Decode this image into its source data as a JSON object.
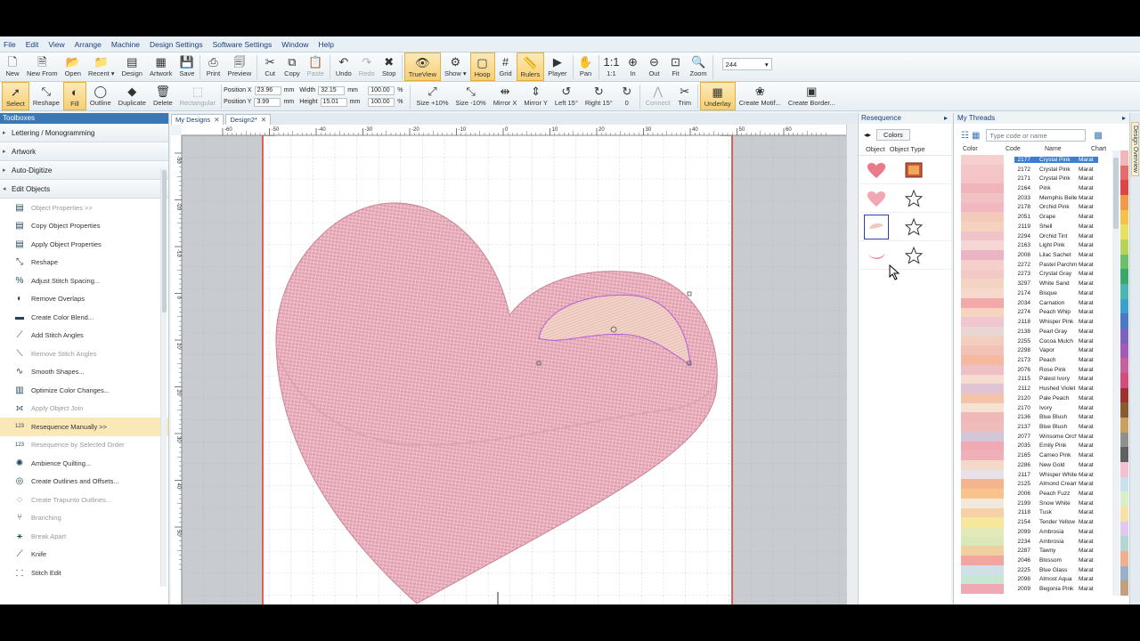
{
  "menu": [
    "File",
    "Edit",
    "View",
    "Arrange",
    "Machine",
    "Design Settings",
    "Software Settings",
    "Window",
    "Help"
  ],
  "toolbar1": [
    {
      "label": "New",
      "icon": "new-file-icon",
      "glyph": "🗋"
    },
    {
      "label": "New From",
      "icon": "new-from-icon",
      "glyph": "🗎"
    },
    {
      "label": "Open",
      "icon": "open-folder-icon",
      "glyph": "📂"
    },
    {
      "label": "Recent ▾",
      "icon": "recent-icon",
      "glyph": "📁"
    },
    {
      "label": "Design",
      "icon": "design-icon",
      "glyph": "▤"
    },
    {
      "label": "Artwork",
      "icon": "artwork-icon",
      "glyph": "▦"
    },
    {
      "label": "Save",
      "icon": "save-icon",
      "glyph": "💾"
    },
    {
      "label": "Print",
      "icon": "print-icon",
      "glyph": "⎙"
    },
    {
      "label": "Preview",
      "icon": "preview-icon",
      "glyph": "🗐"
    },
    {
      "label": "Cut",
      "icon": "cut-icon",
      "glyph": "✂"
    },
    {
      "label": "Copy",
      "icon": "copy-icon",
      "glyph": "⧉"
    },
    {
      "label": "Paste",
      "icon": "paste-icon",
      "glyph": "📋",
      "disabled": true
    },
    {
      "label": "Undo",
      "icon": "undo-icon",
      "glyph": "↶"
    },
    {
      "label": "Redo",
      "icon": "redo-icon",
      "glyph": "↷",
      "disabled": true
    },
    {
      "label": "Stop",
      "icon": "stop-icon",
      "glyph": "✖"
    },
    {
      "label": "TrueView",
      "icon": "trueview-icon",
      "glyph": "👁",
      "active": true
    },
    {
      "label": "Show ▾",
      "icon": "show-icon",
      "glyph": "⚙"
    },
    {
      "label": "Hoop",
      "icon": "hoop-icon",
      "glyph": "▢",
      "active": true
    },
    {
      "label": "Grid",
      "icon": "grid-icon",
      "glyph": "#"
    },
    {
      "label": "Rulers",
      "icon": "rulers-icon",
      "glyph": "📏",
      "active": true
    },
    {
      "label": "Player",
      "icon": "player-icon",
      "glyph": "▶"
    },
    {
      "label": "Pan",
      "icon": "pan-icon",
      "glyph": "✋"
    },
    {
      "label": "1:1",
      "icon": "actual-size-icon",
      "glyph": "1:1"
    },
    {
      "label": "In",
      "icon": "zoom-in-icon",
      "glyph": "⊕"
    },
    {
      "label": "Out",
      "icon": "zoom-out-icon",
      "glyph": "⊖"
    },
    {
      "label": "Fit",
      "icon": "zoom-fit-icon",
      "glyph": "⊡"
    },
    {
      "label": "Zoom",
      "icon": "zoom-icon",
      "glyph": "🔍"
    }
  ],
  "zoom_value": "244",
  "toolbar2": [
    {
      "label": "Select",
      "icon": "select-arrow-icon",
      "glyph": "➚",
      "active": true
    },
    {
      "label": "Reshape",
      "icon": "reshape-icon",
      "glyph": "⤡"
    },
    {
      "label": "Fill",
      "icon": "fill-icon",
      "glyph": "◐",
      "active": true
    },
    {
      "label": "Outline",
      "icon": "outline-icon",
      "glyph": "◯"
    },
    {
      "label": "Duplicate",
      "icon": "duplicate-icon",
      "glyph": "◆"
    },
    {
      "label": "Delete",
      "icon": "delete-icon",
      "glyph": "🗑"
    },
    {
      "label": "Rectangular",
      "icon": "rectangular-select-icon",
      "glyph": "⬚",
      "disabled": true
    }
  ],
  "position": {
    "x_label": "Position X",
    "x_value": "23.96",
    "y_label": "Position Y",
    "y_value": "3.99",
    "unit": "mm"
  },
  "size": {
    "w_label": "Width",
    "w_value": "32.15",
    "h_label": "Height",
    "h_value": "15.01",
    "unit": "mm",
    "pw": "100.00",
    "ph": "100.00",
    "pct": "%"
  },
  "toolbar2b": [
    {
      "label": "Size +10%",
      "icon": "size-up-icon",
      "glyph": "⤢"
    },
    {
      "label": "Size -10%",
      "icon": "size-down-icon",
      "glyph": "⤡"
    },
    {
      "label": "Mirror X",
      "icon": "mirror-x-icon",
      "glyph": "⇹"
    },
    {
      "label": "Mirror Y",
      "icon": "mirror-y-icon",
      "glyph": "⇕"
    },
    {
      "label": "Left 15°",
      "icon": "rotate-left-icon",
      "glyph": "↺"
    },
    {
      "label": "Right 15°",
      "icon": "rotate-right-icon",
      "glyph": "↻"
    },
    {
      "label": "0",
      "icon": "rotate-angle-icon",
      "glyph": "↻"
    },
    {
      "label": "Connect",
      "icon": "connect-icon",
      "glyph": "⋀",
      "disabled": true
    },
    {
      "label": "Trim",
      "icon": "trim-icon",
      "glyph": "✂"
    },
    {
      "label": "Underlay",
      "icon": "underlay-icon",
      "glyph": "▦",
      "active": true
    },
    {
      "label": "Create Motif...",
      "icon": "motif-icon",
      "glyph": "❀"
    },
    {
      "label": "Create Border...",
      "icon": "border-icon",
      "glyph": "▣"
    }
  ],
  "toolbox": {
    "title": "Toolboxes",
    "categories": [
      {
        "label": "Lettering / Monogramming",
        "arrow": "▸"
      },
      {
        "label": "Artwork",
        "arrow": "▸"
      },
      {
        "label": "Auto-Digitize",
        "arrow": "▸"
      },
      {
        "label": "Edit Objects",
        "arrow": "◂"
      }
    ],
    "tools": [
      {
        "label": "Object Properties >>",
        "icon": "object-properties-icon",
        "glyph": "▤",
        "dim": true
      },
      {
        "label": "Copy Object Properties",
        "icon": "copy-properties-icon",
        "glyph": "▤"
      },
      {
        "label": "Apply Object Properties",
        "icon": "apply-properties-icon",
        "glyph": "▤"
      },
      {
        "label": "Reshape",
        "icon": "reshape-tool-icon",
        "glyph": "⤡"
      },
      {
        "label": "Adjust Stitch Spacing...",
        "icon": "stitch-spacing-icon",
        "glyph": "%"
      },
      {
        "label": "Remove Overlaps",
        "icon": "remove-overlaps-icon",
        "glyph": "◐"
      },
      {
        "label": "Create Color Blend...",
        "icon": "color-blend-icon",
        "glyph": "▬"
      },
      {
        "label": "Add Stitch Angles",
        "icon": "add-angles-icon",
        "glyph": "⟋"
      },
      {
        "label": "Remove Stitch Angles",
        "icon": "remove-angles-icon",
        "glyph": "⟍",
        "dim": true
      },
      {
        "label": "Smooth Shapes...",
        "icon": "smooth-shapes-icon",
        "glyph": "∿"
      },
      {
        "label": "Optimize Color Changes...",
        "icon": "optimize-colors-icon",
        "glyph": "▥"
      },
      {
        "label": "Apply Object Join",
        "icon": "object-join-icon",
        "glyph": "⟗",
        "dim": true
      },
      {
        "label": "Resequence Manually >>",
        "icon": "resequence-manual-icon",
        "glyph": "123",
        "sel": true
      },
      {
        "label": "Resequence by Selected Order",
        "icon": "resequence-order-icon",
        "glyph": "123",
        "dim": true
      },
      {
        "label": "Ambience Quilting...",
        "icon": "ambience-quilting-icon",
        "glyph": "✺"
      },
      {
        "label": "Create Outlines and Offsets...",
        "icon": "outlines-offsets-icon",
        "glyph": "◎"
      },
      {
        "label": "Create Trapunto Outlines...",
        "icon": "trapunto-icon",
        "glyph": "◌",
        "dim": true
      },
      {
        "label": "Branching",
        "icon": "branching-icon",
        "glyph": "⑂",
        "dim": true
      },
      {
        "label": "Break Apart",
        "icon": "break-apart-icon",
        "glyph": "⚹",
        "dim": true
      },
      {
        "label": "Knife",
        "icon": "knife-icon",
        "glyph": "⟋"
      },
      {
        "label": "Stitch Edit",
        "icon": "stitch-edit-icon",
        "glyph": "⸬"
      }
    ]
  },
  "tabs": [
    {
      "label": "My Designs"
    },
    {
      "label": "Design2*"
    }
  ],
  "ruler": {
    "h": [
      "-60",
      "-50",
      "-40",
      "-30",
      "-20",
      "-10",
      "0",
      "10",
      "20",
      "30",
      "40",
      "50",
      "60"
    ],
    "v": [
      "-30",
      "-20",
      "-10",
      "0",
      "10",
      "20",
      "30",
      "40",
      "50"
    ]
  },
  "resequence": {
    "title": "Resequence",
    "colors_label": "Colors",
    "col_object": "Object",
    "col_type": "Object Type"
  },
  "threads": {
    "title": "My Threads",
    "placeholder": "Type code or name",
    "headers": [
      "Color",
      "Code",
      "Name",
      "Chart"
    ],
    "rows": [
      {
        "c": "#f6cfcf",
        "code": "2177",
        "name": "Crystal Pink",
        "chart": "Marat",
        "sel": true
      },
      {
        "c": "#f4c6c8",
        "code": "2172",
        "name": "Crystal Pink",
        "chart": "Marat"
      },
      {
        "c": "#f3c3c6",
        "code": "2171",
        "name": "Crystal Pink",
        "chart": "Marat"
      },
      {
        "c": "#f2b4bb",
        "code": "2164",
        "name": "Pink",
        "chart": "Marat"
      },
      {
        "c": "#f0c2c4",
        "code": "2033",
        "name": "Memphis Belle",
        "chart": "Marat"
      },
      {
        "c": "#f2b8c2",
        "code": "2178",
        "name": "Orchid Pink",
        "chart": "Marat"
      },
      {
        "c": "#f3c9ba",
        "code": "2051",
        "name": "Grape",
        "chart": "Marat"
      },
      {
        "c": "#f5d2c0",
        "code": "2119",
        "name": "Shell",
        "chart": "Marat"
      },
      {
        "c": "#f0c4c8",
        "code": "2294",
        "name": "Orchid Tint",
        "chart": "Marat"
      },
      {
        "c": "#f6d6d4",
        "code": "2163",
        "name": "Light Pink",
        "chart": "Marat"
      },
      {
        "c": "#eab4c4",
        "code": "2008",
        "name": "Lilac Sachet",
        "chart": "Marat"
      },
      {
        "c": "#f6cfcc",
        "code": "2272",
        "name": "Pastel Parchment",
        "chart": "Marat"
      },
      {
        "c": "#f2c9c5",
        "code": "2273",
        "name": "Crystal Gray",
        "chart": "Marat"
      },
      {
        "c": "#f3d3c2",
        "code": "3297",
        "name": "White Sand",
        "chart": "Marat"
      },
      {
        "c": "#f6d8cc",
        "code": "2174",
        "name": "Bisque",
        "chart": "Marat"
      },
      {
        "c": "#f2a9a8",
        "code": "2034",
        "name": "Carnation",
        "chart": "Marat"
      },
      {
        "c": "#f7d4c0",
        "code": "2274",
        "name": "Peach Whip",
        "chart": "Marat"
      },
      {
        "c": "#f0c7d0",
        "code": "2118",
        "name": "Whisper Pink",
        "chart": "Marat"
      },
      {
        "c": "#e9d6d2",
        "code": "2138",
        "name": "Pearl Gray",
        "chart": "Marat"
      },
      {
        "c": "#f3cdbd",
        "code": "2255",
        "name": "Cocoa Mulch",
        "chart": "Marat"
      },
      {
        "c": "#f2c2b8",
        "code": "2298",
        "name": "Vapor",
        "chart": "Marat"
      },
      {
        "c": "#f4b99e",
        "code": "2173",
        "name": "Peach",
        "chart": "Marat"
      },
      {
        "c": "#efc0c6",
        "code": "2076",
        "name": "Rose Pink",
        "chart": "Marat"
      },
      {
        "c": "#f5dccf",
        "code": "2115",
        "name": "Palest Ivory",
        "chart": "Marat"
      },
      {
        "c": "#e0c4d4",
        "code": "2112",
        "name": "Hushed Violet",
        "chart": "Marat"
      },
      {
        "c": "#f4c3a9",
        "code": "2120",
        "name": "Pale Peach",
        "chart": "Marat"
      },
      {
        "c": "#f6e2d2",
        "code": "2170",
        "name": "Ivory",
        "chart": "Marat"
      },
      {
        "c": "#f0b8b8",
        "code": "2136",
        "name": "Blue Blush",
        "chart": "Marat"
      },
      {
        "c": "#eebdbb",
        "code": "2137",
        "name": "Blue Blush",
        "chart": "Marat"
      },
      {
        "c": "#d4c6d6",
        "code": "2077",
        "name": "Winsome Orchid",
        "chart": "Marat"
      },
      {
        "c": "#f1a9b4",
        "code": "2035",
        "name": "Emily Pink",
        "chart": "Marat"
      },
      {
        "c": "#f0b0b8",
        "code": "2165",
        "name": "Cameo Pink",
        "chart": "Marat"
      },
      {
        "c": "#f4d8c8",
        "code": "2286",
        "name": "New Gold",
        "chart": "Marat"
      },
      {
        "c": "#e8e2e8",
        "code": "2117",
        "name": "Whisper White",
        "chart": "Marat"
      },
      {
        "c": "#f4b58e",
        "code": "2125",
        "name": "Almond Cream",
        "chart": "Marat"
      },
      {
        "c": "#f8c48c",
        "code": "2006",
        "name": "Peach Fuzz",
        "chart": "Marat"
      },
      {
        "c": "#f2e8dc",
        "code": "2199",
        "name": "Snow White",
        "chart": "Marat"
      },
      {
        "c": "#f6d0a6",
        "code": "2118",
        "name": "Tusk",
        "chart": "Marat"
      },
      {
        "c": "#f6e89a",
        "code": "2154",
        "name": "Tender Yellow",
        "chart": "Marat"
      },
      {
        "c": "#e3eab8",
        "code": "2099",
        "name": "Ambrosia",
        "chart": "Marat"
      },
      {
        "c": "#d8e8b8",
        "code": "2234",
        "name": "Ambrosia",
        "chart": "Marat"
      },
      {
        "c": "#f1d0a0",
        "code": "2287",
        "name": "Tawny",
        "chart": "Marat"
      },
      {
        "c": "#f3a6a0",
        "code": "2046",
        "name": "Blossom",
        "chart": "Marat"
      },
      {
        "c": "#cfe0e8",
        "code": "2225",
        "name": "Blue Glass",
        "chart": "Marat"
      },
      {
        "c": "#c8e6d4",
        "code": "2098",
        "name": "Almost Aqua",
        "chart": "Marat"
      },
      {
        "c": "#f0a8b4",
        "code": "2009",
        "name": "Begonia Pink",
        "chart": "Marat"
      }
    ]
  },
  "palette": [
    "#f2b6b8",
    "#e96a6a",
    "#d44",
    "#f39a4a",
    "#f6c14a",
    "#e8e060",
    "#b6d45a",
    "#6cc06c",
    "#3aa86a",
    "#48b8b0",
    "#3aa0d0",
    "#4a78c8",
    "#7a62c0",
    "#a45ab8",
    "#c860a0",
    "#d44c7c",
    "#a03030",
    "#8a5a30",
    "#c8a060",
    "#909090",
    "#606060",
    "#f2c0d0",
    "#c8e0f0",
    "#d8f0c8",
    "#f8e0a8",
    "#e0c8f0",
    "#b0d8d0",
    "#f0b090",
    "#9ab0c8",
    "#c0a080"
  ],
  "sidetab": "Design Overview"
}
